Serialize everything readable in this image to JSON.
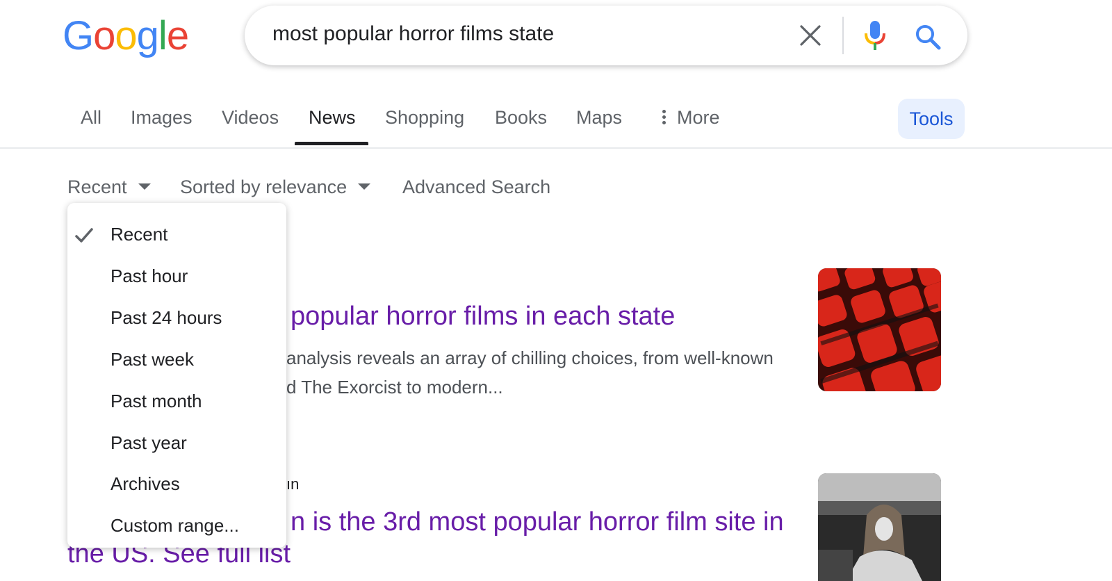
{
  "logo": {
    "letters": [
      {
        "ch": "G",
        "color": "#4285f4"
      },
      {
        "ch": "o",
        "color": "#ea4335"
      },
      {
        "ch": "o",
        "color": "#fbbc05"
      },
      {
        "ch": "g",
        "color": "#4285f4"
      },
      {
        "ch": "l",
        "color": "#34a853"
      },
      {
        "ch": "e",
        "color": "#ea4335"
      }
    ]
  },
  "search": {
    "query": "most popular horror films state"
  },
  "icons": {
    "clear": "close-icon",
    "mic": "microphone-icon",
    "search": "search-icon",
    "more": "vertical-dots-icon",
    "check": "check-icon"
  },
  "tabs": [
    {
      "label": "All",
      "active": false
    },
    {
      "label": "Images",
      "active": false
    },
    {
      "label": "Videos",
      "active": false
    },
    {
      "label": "News",
      "active": true
    },
    {
      "label": "Shopping",
      "active": false
    },
    {
      "label": "Books",
      "active": false
    },
    {
      "label": "Maps",
      "active": false
    },
    {
      "label": "More",
      "active": false
    }
  ],
  "tools_label": "Tools",
  "filters": {
    "time": "Recent",
    "sort": "Sorted by relevance",
    "advanced": "Advanced Search"
  },
  "time_menu": {
    "selected": "Recent",
    "options": [
      "Recent",
      "Past hour",
      "Past 24 hours",
      "Past week",
      "Past month",
      "Past year",
      "Archives",
      "Custom range..."
    ]
  },
  "results": [
    {
      "title_visible": "popular horror films in each state",
      "snippet_line1": "analysis reveals an array of chilling choices, from well-known",
      "snippet_line2": "d The Exorcist to modern..."
    },
    {
      "source_visible": "ın",
      "title_line1_visible": "n is the 3rd most popular horror film site in",
      "title_line2_visible": "the US. See full list"
    }
  ],
  "colors": {
    "visited_link": "#681da8",
    "tools_bg": "#e8f0fe",
    "tools_text": "#1a56d6"
  }
}
